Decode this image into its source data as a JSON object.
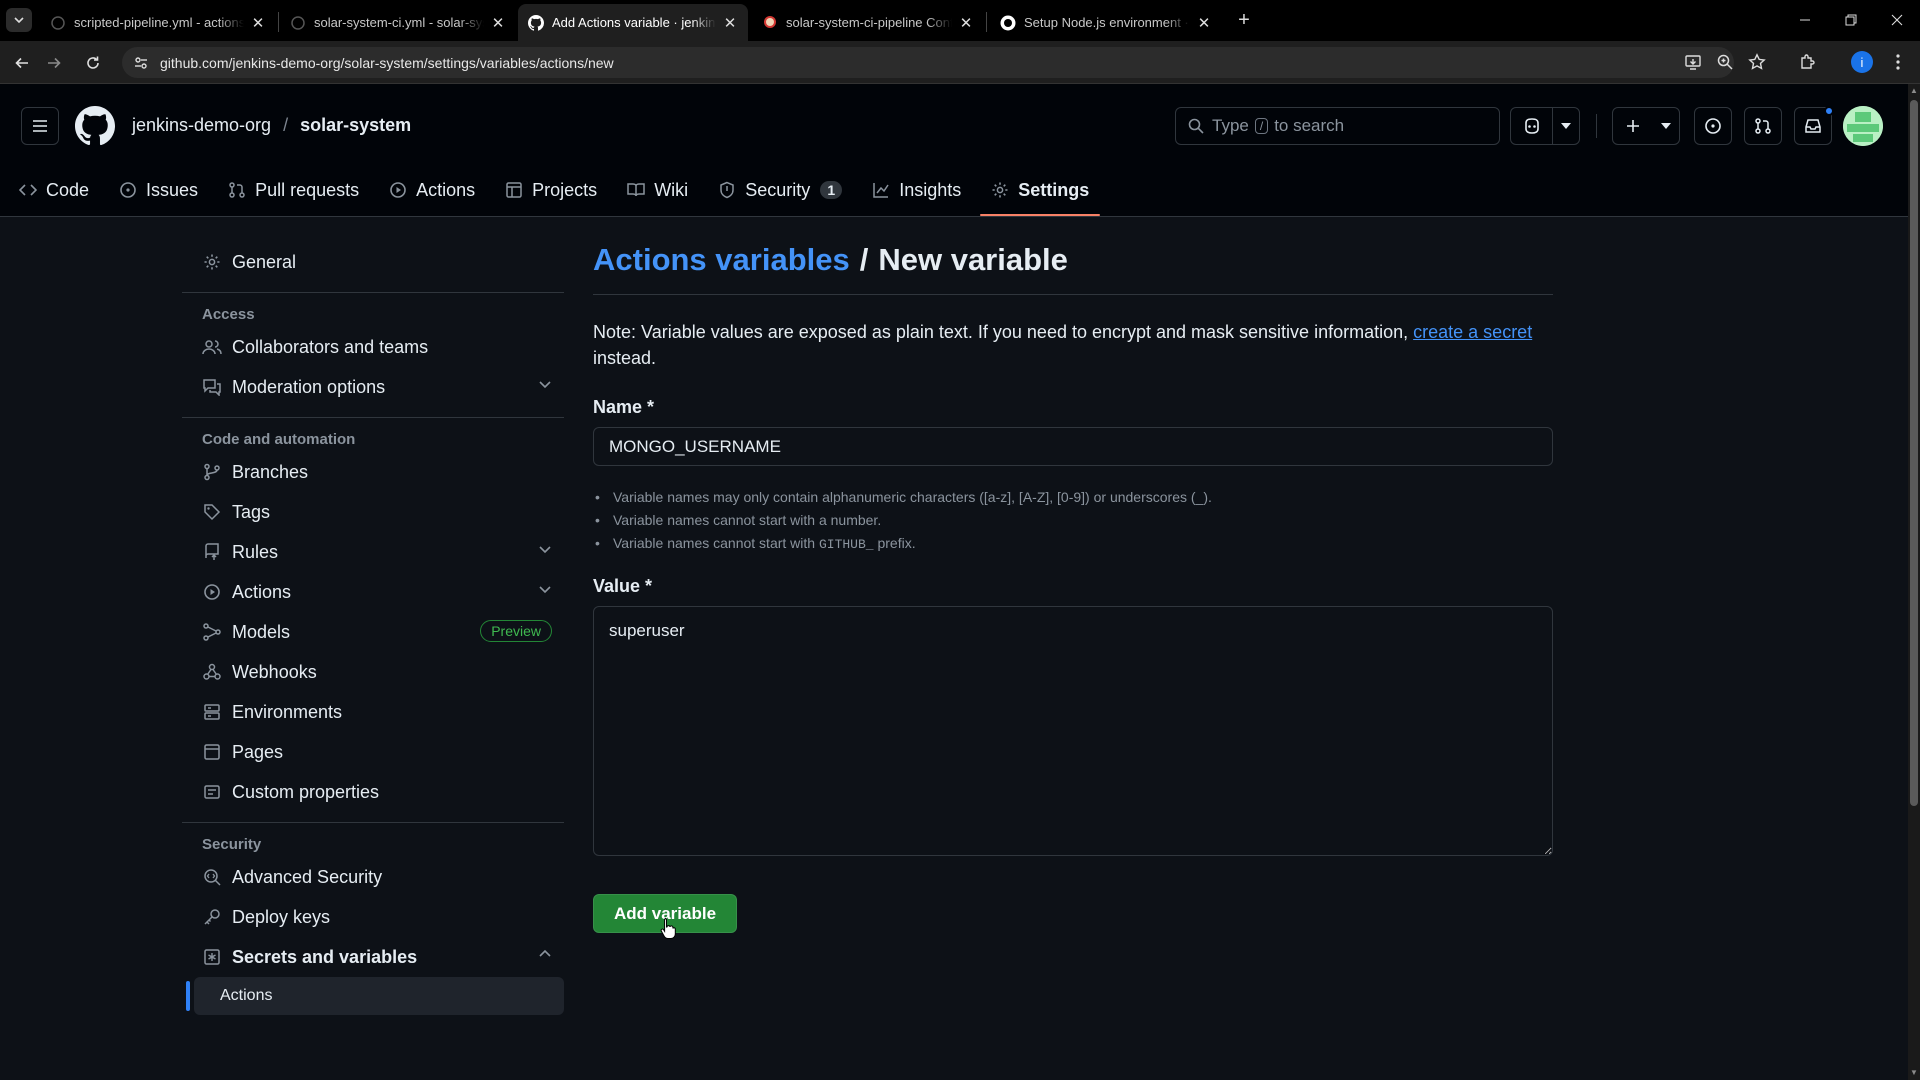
{
  "browser": {
    "tabs": [
      {
        "title": "scripted-pipeline.yml - actions-",
        "close": "✕"
      },
      {
        "title": "solar-system-ci.yml - solar-syst",
        "close": "✕"
      },
      {
        "title": "Add Actions variable · jenkins-d",
        "close": "✕"
      },
      {
        "title": "solar-system-ci-pipeline Config",
        "close": "✕"
      },
      {
        "title": "Setup Node.js environment · Ac",
        "close": "✕"
      }
    ],
    "new_tab": "+",
    "url": "github.com/jenkins-demo-org/solar-system/settings/variables/actions/new",
    "profile_initial": "i"
  },
  "header": {
    "owner": "jenkins-demo-org",
    "slash": "/",
    "repo": "solar-system",
    "search_prefix": "Type",
    "search_key": "/",
    "search_suffix": "to search",
    "nav": [
      {
        "label": "Code",
        "icon": "code-icon"
      },
      {
        "label": "Issues",
        "icon": "issue-icon"
      },
      {
        "label": "Pull requests",
        "icon": "pull-request-icon"
      },
      {
        "label": "Actions",
        "icon": "play-icon"
      },
      {
        "label": "Projects",
        "icon": "table-icon"
      },
      {
        "label": "Wiki",
        "icon": "book-icon"
      },
      {
        "label": "Security",
        "icon": "shield-icon",
        "count": "1"
      },
      {
        "label": "Insights",
        "icon": "graph-icon"
      },
      {
        "label": "Settings",
        "icon": "gear-icon"
      }
    ],
    "accent": "#f78166"
  },
  "sidebar": {
    "general": "General",
    "access_heading": "Access",
    "collaborators": "Collaborators and teams",
    "moderation": "Moderation options",
    "code_heading": "Code and automation",
    "branches": "Branches",
    "tags": "Tags",
    "rules": "Rules",
    "actions": "Actions",
    "models": "Models",
    "models_badge": "Preview",
    "webhooks": "Webhooks",
    "environments": "Environments",
    "pages": "Pages",
    "custom_properties": "Custom properties",
    "security_heading": "Security",
    "advanced_security": "Advanced Security",
    "deploy_keys": "Deploy keys",
    "secrets": "Secrets and variables",
    "secrets_actions": "Actions"
  },
  "main": {
    "crumb_link": "Actions variables",
    "crumb_sep": "/",
    "title": "New variable",
    "note_text": "Note: Variable values are exposed as plain text. If you need to encrypt and mask sensitive information,",
    "note_link": "create a secret",
    "note_tail": "instead.",
    "name_label": "Name *",
    "name_value": "MONGO_USERNAME",
    "rule_1": "Variable names may only contain alphanumeric characters ([a-z], [A-Z], [0-9]) or underscores (_).",
    "rule_2": "Variable names cannot start with a number.",
    "rule_3_pre": "Variable names cannot start with",
    "rule_3_code": "GITHUB_",
    "rule_3_post": "prefix.",
    "value_label": "Value *",
    "value_value": "superuser",
    "submit_label": "Add variable",
    "submit_color": "#238636"
  }
}
